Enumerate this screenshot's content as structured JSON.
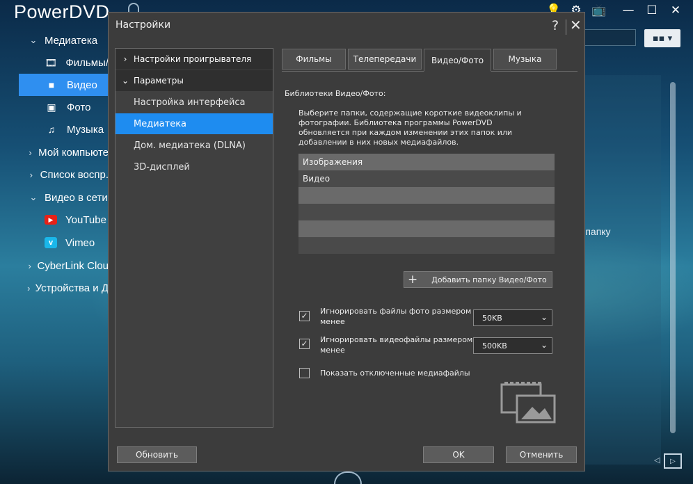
{
  "app": {
    "title": "PowerDVD"
  },
  "toolbar": {
    "view_icon": "grid-view-icon",
    "view_label": "▪▪ ▾"
  },
  "nav": {
    "items": [
      {
        "label": "Медиатека",
        "icon": "chevron-down-icon",
        "level": 0
      },
      {
        "label": "Фильмы/",
        "icon": "film-icon",
        "level": 1
      },
      {
        "label": "Видео",
        "icon": "video-camera-icon",
        "level": 1,
        "active": true
      },
      {
        "label": "Фото",
        "icon": "photo-icon",
        "level": 1
      },
      {
        "label": "Музыка",
        "icon": "music-note-icon",
        "level": 1
      },
      {
        "label": "Мой компьюте",
        "icon": "chevron-right-icon",
        "level": 0
      },
      {
        "label": "Список воспр.",
        "icon": "chevron-right-icon",
        "level": 0
      },
      {
        "label": "Видео в сети",
        "icon": "chevron-down-icon",
        "level": 0
      },
      {
        "label": "YouTube",
        "icon": "youtube-icon",
        "level": 1
      },
      {
        "label": "Vimeo",
        "icon": "vimeo-icon",
        "level": 1
      },
      {
        "label": "CyberLink Clou",
        "icon": "chevron-right-icon",
        "level": 0
      },
      {
        "label": "Устройства и Д",
        "icon": "chevron-right-icon",
        "level": 0
      }
    ]
  },
  "background": {
    "hint_text": "в папку"
  },
  "dialog": {
    "title": "Настройки",
    "help": "?",
    "close": "✕",
    "tree": {
      "sections": [
        {
          "label": "Настройки проигрывателя",
          "expanded": false
        },
        {
          "label": "Параметры",
          "expanded": true
        }
      ],
      "items": [
        "Настройка интерфейса",
        "Медиатека",
        "Дом. медиатека (DLNA)",
        "3D-дисплей"
      ],
      "selected": "Медиатека"
    },
    "tabs": [
      {
        "label": "Фильмы"
      },
      {
        "label": "Телепередачи"
      },
      {
        "label": "Видео/Фото",
        "active": true
      },
      {
        "label": "Музыка"
      }
    ],
    "section_title": "Библиотеки Видео/Фото:",
    "description": "Выберите папки, содержащие короткие видеоклипы и фотографии. Библиотека программы PowerDVD обновляется при каждом изменении этих папок или добавлении в них новых медиафайлов.",
    "folders": [
      "Изображения",
      "Видео",
      "",
      "",
      "",
      ""
    ],
    "add_folder_button": "Добавить папку Видео/Фото",
    "options": [
      {
        "label": "Игнорировать файлы фото размером менее",
        "checked": true,
        "value": "50KB"
      },
      {
        "label": "Игнорировать видеофайлы размером менее",
        "checked": true,
        "value": "500KB"
      },
      {
        "label": "Показать отключенные медиафайлы",
        "checked": false
      }
    ],
    "buttons": {
      "refresh": "Обновить",
      "ok": "OK",
      "cancel": "Отменить"
    }
  },
  "colors": {
    "accent": "#1e8cf0",
    "dialog_bg": "#3c3c3c",
    "tree_header": "#2f2f2f"
  }
}
